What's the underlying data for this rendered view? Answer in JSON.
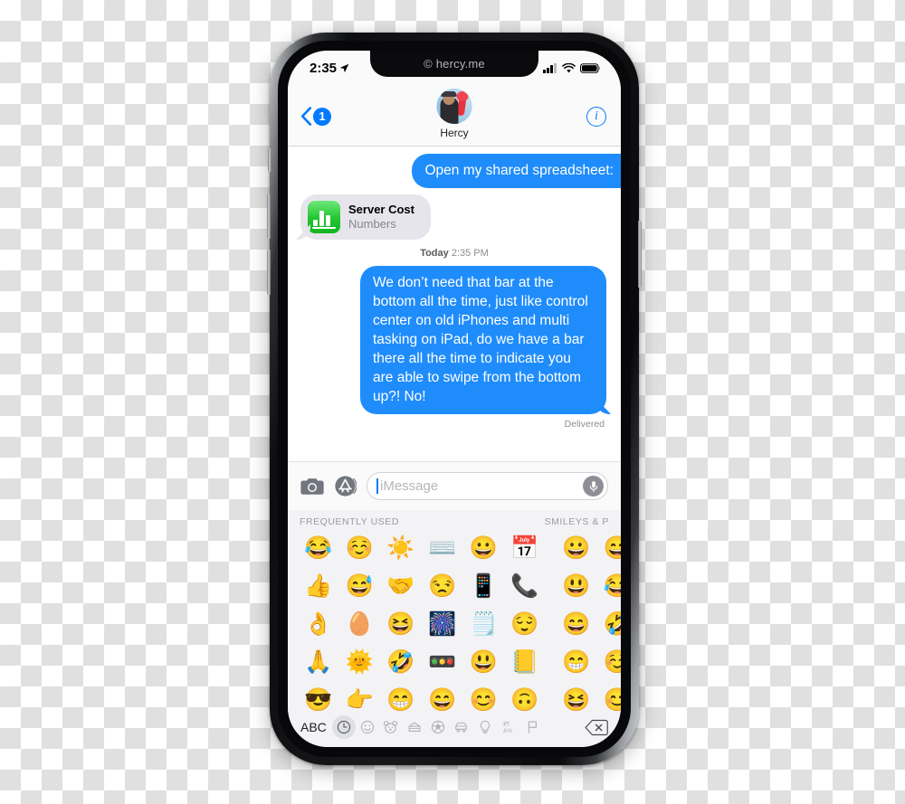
{
  "watermark": "© hercy.me",
  "status_bar": {
    "time": "2:35",
    "location_icon": "location-arrow-icon",
    "signal_icon": "cellular-signal-icon",
    "signal_bars_filled": 3,
    "signal_bars_total": 4,
    "wifi_icon": "wifi-icon",
    "battery_icon": "battery-full-icon"
  },
  "nav": {
    "back_icon": "chevron-left-icon",
    "back_badge": "1",
    "contact_name": "Hercy",
    "avatar_icon": "contact-avatar",
    "info_icon": "info-circle-icon",
    "info_label": "i"
  },
  "conversation": {
    "messages": [
      {
        "id": "msg-1",
        "direction": "outgoing",
        "text": "Open my shared spreadsheet:"
      },
      {
        "id": "attachment-1",
        "direction": "incoming",
        "type": "attachment",
        "title": "Server Cost",
        "subtitle": "Numbers",
        "app_icon": "numbers-app-icon"
      }
    ],
    "timestamp_label": "Today",
    "timestamp_time": "2:35 PM",
    "message_2": {
      "id": "msg-2",
      "direction": "outgoing",
      "text": "We don’t need that      bar at the bottom all the time, just like control center on old iPhones and multi tasking on iPad, do we have a bar there all the time to indicate you are able to swipe from the bottom up?! No!"
    },
    "delivered_label": "Delivered",
    "bubble_color": "#1f8cfb",
    "incoming_bubble_color": "#e6e5eb"
  },
  "input_bar": {
    "camera_icon": "camera-icon",
    "appstore_icon": "app-store-icon",
    "placeholder": "iMessage",
    "value": "",
    "mic_icon": "microphone-icon"
  },
  "emoji_keyboard": {
    "section_left": "FREQUENTLY USED",
    "section_right": "SMILEYS & P",
    "frequently_used": [
      "😂",
      "☺️",
      "☀️",
      "⌨️",
      "😀",
      "📅",
      "👍",
      "😅",
      "🤝",
      "😒",
      "📱",
      "📞",
      "👌",
      "🥚",
      "😆",
      "🎆",
      "🗒️",
      "😌",
      "🙏",
      "🌞",
      "🤣",
      "🚥",
      "😃",
      "📒",
      "😎",
      "👉",
      "😁",
      "😄",
      "😊",
      "🙃"
    ],
    "smileys_page": [
      "😀",
      "😅",
      "😃",
      "😂",
      "😄",
      "🤣",
      "😁",
      "☺️",
      "😆",
      "😊"
    ],
    "toolbar": {
      "abc_label": "ABC",
      "categories": [
        {
          "name": "recently-used",
          "icon": "clock-icon",
          "selected": true
        },
        {
          "name": "smileys-people",
          "icon": "smiley-icon",
          "selected": false
        },
        {
          "name": "animals-nature",
          "icon": "bear-icon",
          "selected": false
        },
        {
          "name": "food-drink",
          "icon": "food-icon",
          "selected": false
        },
        {
          "name": "activity",
          "icon": "soccer-ball-icon",
          "selected": false
        },
        {
          "name": "travel-places",
          "icon": "car-icon",
          "selected": false
        },
        {
          "name": "objects",
          "icon": "lightbulb-icon",
          "selected": false
        },
        {
          "name": "symbols",
          "icon": "symbols-icon",
          "selected": false
        },
        {
          "name": "flags",
          "icon": "flag-icon",
          "selected": false
        }
      ],
      "delete_icon": "backspace-delete-icon"
    }
  }
}
